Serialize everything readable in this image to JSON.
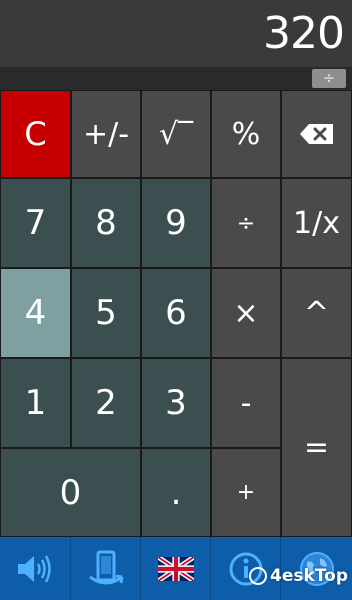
{
  "display": {
    "value": "320",
    "operator_indicator": "÷"
  },
  "keys": {
    "clear": "C",
    "plus_minus": "+/-",
    "sqrt": "√‾",
    "percent": "%",
    "seven": "7",
    "eight": "8",
    "nine": "9",
    "divide": "÷",
    "reciprocal": "1/x",
    "four": "4",
    "five": "5",
    "six": "6",
    "multiply": "×",
    "power": "^",
    "one": "1",
    "two": "2",
    "three": "3",
    "minus": "-",
    "equals": "=",
    "zero": "0",
    "decimal": ".",
    "plus": "+"
  },
  "toolbar": {
    "icons": [
      "speaker-icon",
      "phone-rotate-icon",
      "uk-flag-icon",
      "info-icon",
      "globe-icon"
    ]
  },
  "watermark": {
    "text": "4eskTop"
  },
  "colors": {
    "display_bg": "#3a3a3a",
    "clear_key": "#c60000",
    "number_key": "#3c4f50",
    "active_key": "#7fa0a0",
    "function_key": "#4a4a4a",
    "toolbar": "#0d5da8"
  }
}
